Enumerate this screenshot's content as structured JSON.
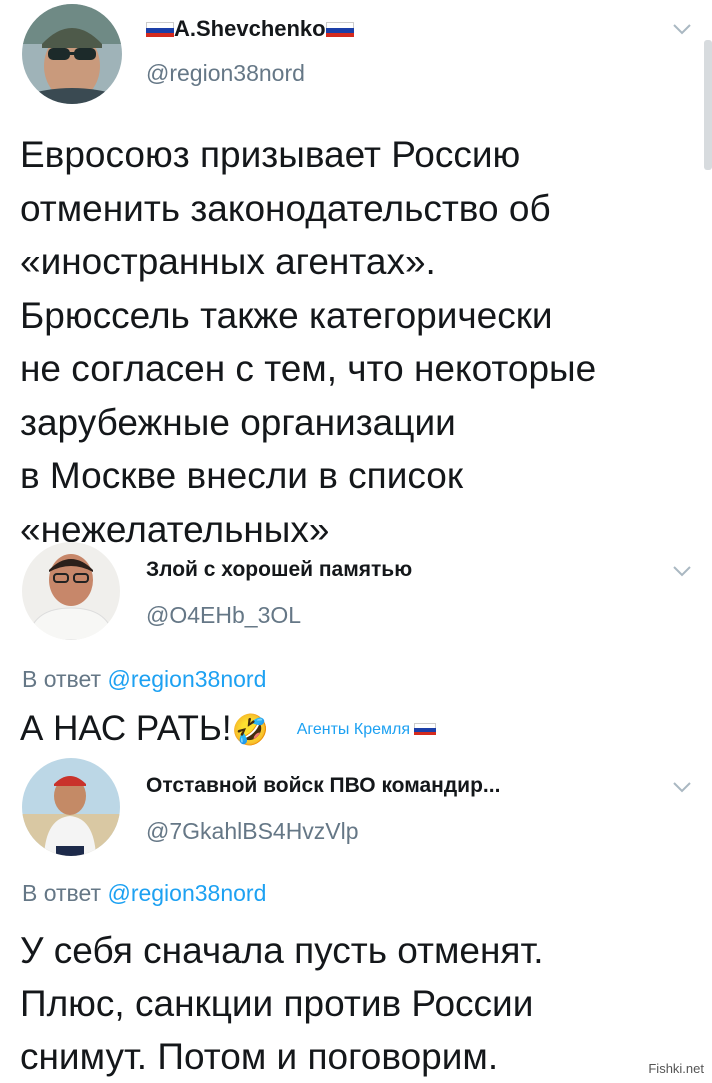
{
  "tweet1": {
    "display_name": "A.Shevchenko",
    "handle": "@region38nord",
    "text_lines": [
      "Евросоюз призывает Россию",
      "отменить законодательство об",
      "«иностранных агентах».",
      "Брюссель также категорически",
      "не согласен с тем, что некоторые",
      "зарубежные организации",
      "в Москве внесли в список",
      "«нежелательных»"
    ]
  },
  "tweet2": {
    "display_name": "Злой с хорошей памятью",
    "handle": "@O4EHb_3OL",
    "reply_prefix": "В ответ",
    "reply_handle": "@region38nord",
    "text": "А НАС РАТЬ!",
    "emoji": "🤣",
    "tag": "Агенты Кремля"
  },
  "tweet3": {
    "display_name": "Отставной войск ПВО командир...",
    "handle": "@7GkahlBS4HvzVlp",
    "reply_prefix": "В ответ",
    "reply_handle": "@region38nord",
    "text_lines": [
      "У себя сначала пусть отменят.",
      "Плюс, санкции против России",
      "снимут. Потом и поговорим."
    ]
  },
  "watermark": "Fishki.net",
  "colors": {
    "link": "#1da1f2",
    "muted": "#657786",
    "text": "#14171a"
  }
}
